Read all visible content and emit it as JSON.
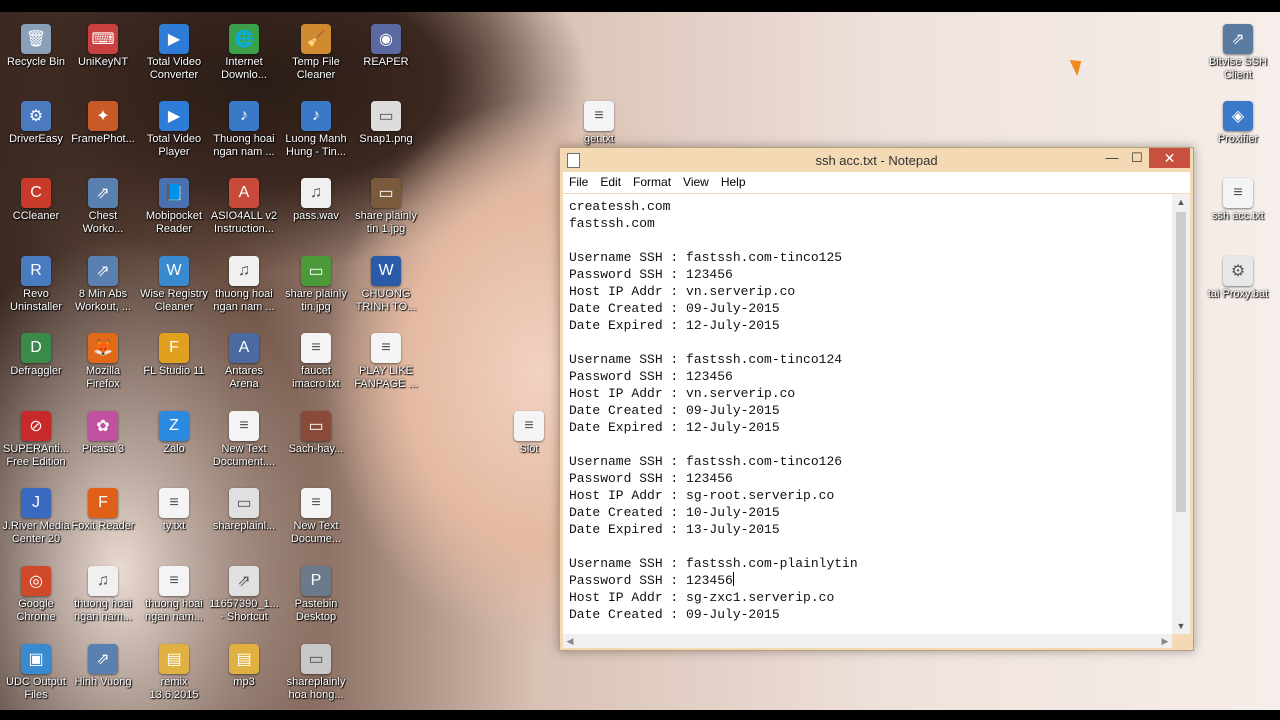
{
  "desktop_icons": [
    {
      "label": "Recycle Bin",
      "icon": "recycle-bin-icon",
      "color": "#8aa0b8",
      "glyph": "🗑"
    },
    {
      "label": "UniKeyNT",
      "icon": "unikey-icon",
      "color": "#c84040",
      "glyph": "⌨"
    },
    {
      "label": "Total Video\nConverter",
      "icon": "video-converter-icon",
      "color": "#2f7bd8",
      "glyph": "▶"
    },
    {
      "label": "Internet\nDownlo...",
      "icon": "idm-icon",
      "color": "#3aa04a",
      "glyph": "🌐"
    },
    {
      "label": "Temp File\nCleaner",
      "icon": "temp-cleaner-icon",
      "color": "#d08a30",
      "glyph": "🧹"
    },
    {
      "label": "REAPER",
      "icon": "reaper-icon",
      "color": "#5a6aa0",
      "glyph": "◉"
    },
    {
      "label": "DriverEasy",
      "icon": "drivereasy-icon",
      "color": "#4a7ac0",
      "glyph": "⚙"
    },
    {
      "label": "FramePhot...",
      "icon": "framephoto-icon",
      "color": "#c85a2a",
      "glyph": "✦"
    },
    {
      "label": "Total Video\nPlayer",
      "icon": "video-player-icon",
      "color": "#2f7bd8",
      "glyph": "▶"
    },
    {
      "label": "Thuong hoai\nngan nam ...",
      "icon": "audio-file-icon",
      "color": "#3a78c8",
      "glyph": "♪"
    },
    {
      "label": "Luong Manh\nHung - Tin...",
      "icon": "audio-file-icon",
      "color": "#3a78c8",
      "glyph": "♪"
    },
    {
      "label": "Snap1.png",
      "icon": "image-file-icon",
      "color": "#dddddd",
      "glyph": "▭"
    },
    {
      "label": "CCleaner",
      "icon": "ccleaner-icon",
      "color": "#c83a2a",
      "glyph": "C"
    },
    {
      "label": "Chest\nWorko...",
      "icon": "shortcut-icon",
      "color": "#5a80b0",
      "glyph": "⇗"
    },
    {
      "label": "Mobipocket\nReader",
      "icon": "mobipocket-icon",
      "color": "#4a70b0",
      "glyph": "📘"
    },
    {
      "label": "ASIO4ALL v2\nInstruction...",
      "icon": "pdf-icon",
      "color": "#c84a3a",
      "glyph": "A"
    },
    {
      "label": "pass.wav",
      "icon": "wav-file-icon",
      "color": "#f0f0f0",
      "glyph": "♫"
    },
    {
      "label": "share plainly\ntin 1.jpg",
      "icon": "image-file-icon",
      "color": "#7a5a3a",
      "glyph": "▭"
    },
    {
      "label": "Revo\nUninstaller",
      "icon": "revo-icon",
      "color": "#4a7ac0",
      "glyph": "R"
    },
    {
      "label": "8 Min Abs\nWorkout, ...",
      "icon": "shortcut-icon",
      "color": "#5a80b0",
      "glyph": "⇗"
    },
    {
      "label": "Wise Registry\nCleaner",
      "icon": "wise-registry-icon",
      "color": "#3a8ad0",
      "glyph": "W"
    },
    {
      "label": "thuong hoai\nngan nam ...",
      "icon": "wav-file-icon",
      "color": "#f0f0f0",
      "glyph": "♫"
    },
    {
      "label": "share plainly\ntin.jpg",
      "icon": "image-file-icon",
      "color": "#4a9a3a",
      "glyph": "▭"
    },
    {
      "label": "CHUONG\nTRINH TO...",
      "icon": "word-doc-icon",
      "color": "#2a5aa8",
      "glyph": "W"
    },
    {
      "label": "Defraggler",
      "icon": "defraggler-icon",
      "color": "#3a8a4a",
      "glyph": "D"
    },
    {
      "label": "Mozilla\nFirefox",
      "icon": "firefox-icon",
      "color": "#e06a1a",
      "glyph": "🦊"
    },
    {
      "label": "FL Studio 11",
      "icon": "fl-studio-icon",
      "color": "#e0a020",
      "glyph": "F"
    },
    {
      "label": "Antares\nArena",
      "icon": "antares-icon",
      "color": "#4a6aa0",
      "glyph": "A"
    },
    {
      "label": "faucet\nimacro.txt",
      "icon": "text-file-icon",
      "color": "#f4f4f4",
      "glyph": "≡"
    },
    {
      "label": "PLAY LIKE\nFANPAGE ...",
      "icon": "text-file-icon",
      "color": "#f4f4f4",
      "glyph": "≡"
    },
    {
      "label": "SUPERAnti...\nFree Edition",
      "icon": "superantispyware-icon",
      "color": "#c82a2a",
      "glyph": "⊘"
    },
    {
      "label": "Picasa 3",
      "icon": "picasa-icon",
      "color": "#c050a0",
      "glyph": "✿"
    },
    {
      "label": "Zalo",
      "icon": "zalo-icon",
      "color": "#2a8ae0",
      "glyph": "Z"
    },
    {
      "label": "New Text\nDocument....",
      "icon": "text-file-icon",
      "color": "#f4f4f4",
      "glyph": "≡"
    },
    {
      "label": "Sach-hay...",
      "icon": "image-file-icon",
      "color": "#8a4a3a",
      "glyph": "▭"
    },
    {
      "label": "J.River Media\nCenter 20",
      "icon": "jriver-icon",
      "color": "#3a6ac0",
      "glyph": "J"
    },
    {
      "label": "Foxit Reader",
      "icon": "foxit-icon",
      "color": "#e0601a",
      "glyph": "F"
    },
    {
      "label": "ty.txt",
      "icon": "text-file-icon",
      "color": "#f4f4f4",
      "glyph": "≡"
    },
    {
      "label": "shareplainl...",
      "icon": "image-file-icon",
      "color": "#e0e0e0",
      "glyph": "▭"
    },
    {
      "label": "New Text\nDocume...",
      "icon": "text-file-icon",
      "color": "#f4f4f4",
      "glyph": "≡"
    },
    {
      "label": "Google\nChrome",
      "icon": "chrome-icon",
      "color": "#d04a2a",
      "glyph": "◎"
    },
    {
      "label": "thuong hoai\nngan nam...",
      "icon": "wav-file-icon",
      "color": "#f0f0f0",
      "glyph": "♫"
    },
    {
      "label": "thuong hoai\nngan nam...",
      "icon": "text-file-icon",
      "color": "#f4f4f4",
      "glyph": "≡"
    },
    {
      "label": "11657390_1...\n- Shortcut",
      "icon": "shortcut-icon",
      "color": "#e0e0e0",
      "glyph": "⇗"
    },
    {
      "label": "Pastebin\nDesktop",
      "icon": "pastebin-icon",
      "color": "#6a7a8a",
      "glyph": "P"
    },
    {
      "label": "UDC Output\nFiles",
      "icon": "folder-icon",
      "color": "#3a8ad0",
      "glyph": "▣"
    },
    {
      "label": "Hinh Vuong",
      "icon": "shortcut-icon",
      "color": "#5a80b0",
      "glyph": "⇗"
    },
    {
      "label": "remix\n13.6.2015",
      "icon": "folder-icon",
      "color": "#e0b040",
      "glyph": "▤"
    },
    {
      "label": "mp3",
      "icon": "folder-icon",
      "color": "#e0b040",
      "glyph": "▤"
    },
    {
      "label": "shareplainly\nhoa hong...",
      "icon": "image-file-icon",
      "color": "#c8c8c8",
      "glyph": "▭"
    },
    {
      "label": "get.txt",
      "icon": "text-file-icon",
      "color": "#f4f4f4",
      "glyph": "≡"
    },
    {
      "label": "Slot",
      "icon": "text-file-icon",
      "color": "#f4f4f4",
      "glyph": "≡"
    },
    {
      "label": "Bitvise SSH\nClient",
      "icon": "bitvise-icon",
      "color": "#5a7aa0",
      "glyph": "⇗"
    },
    {
      "label": "Proxifier",
      "icon": "proxifier-icon",
      "color": "#3a7ac8",
      "glyph": "◈"
    },
    {
      "label": "ssh acc.txt",
      "icon": "text-file-icon",
      "color": "#f4f4f4",
      "glyph": "≡"
    },
    {
      "label": "tai Proxy.bat",
      "icon": "bat-file-icon",
      "color": "#e8e8e8",
      "glyph": "⚙"
    }
  ],
  "notepad": {
    "title": "ssh acc.txt - Notepad",
    "minimize_glyph": "—",
    "maximize_glyph": "☐",
    "close_glyph": "✕",
    "menu": [
      "File",
      "Edit",
      "Format",
      "View",
      "Help"
    ],
    "lines": [
      "createssh.com",
      "fastssh.com",
      "",
      "Username SSH : fastssh.com-tinco125",
      "Password SSH : 123456",
      "Host IP Addr : vn.serverip.co",
      "Date Created : 09-July-2015",
      "Date Expired : 12-July-2015",
      "",
      "Username SSH : fastssh.com-tinco124",
      "Password SSH : 123456",
      "Host IP Addr : vn.serverip.co",
      "Date Created : 09-July-2015",
      "Date Expired : 12-July-2015",
      "",
      "Username SSH : fastssh.com-tinco126",
      "Password SSH : 123456",
      "Host IP Addr : sg-root.serverip.co",
      "Date Created : 10-July-2015",
      "Date Expired : 13-July-2015",
      "",
      "Username SSH : fastssh.com-plainlytin",
      "Password SSH : 123456",
      "Host IP Addr : sg-zxc1.serverip.co",
      "Date Created : 09-July-2015"
    ],
    "caret_line": 22
  }
}
